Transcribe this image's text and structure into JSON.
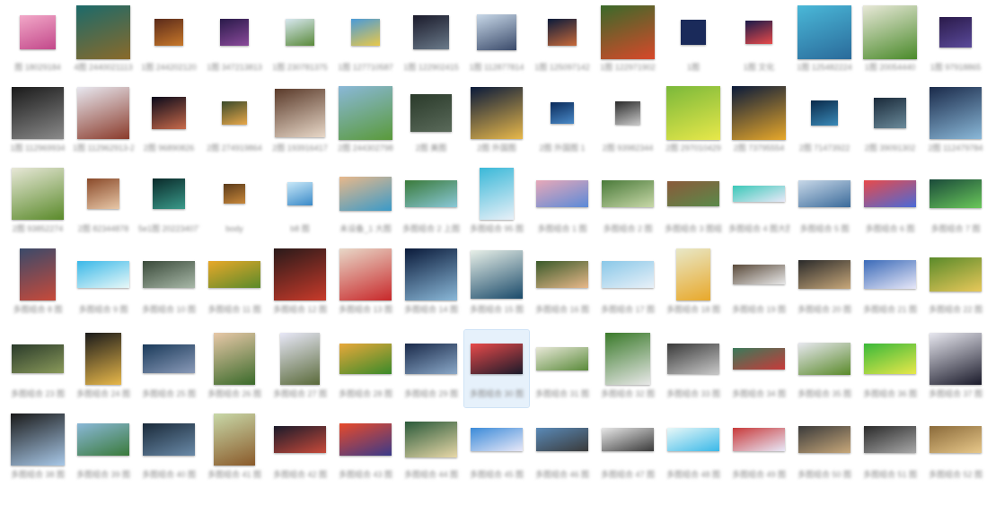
{
  "explorer": {
    "view": "large-icons",
    "selected_index": 67,
    "columns": 15,
    "rows": 6,
    "items": [
      {
        "name": "图 18029184",
        "thumb": {
          "w": 40,
          "h": 38,
          "c1": "#f2a8c8",
          "c2": "#c2488a"
        }
      },
      {
        "name": "4图 2440021113",
        "thumb": {
          "w": 60,
          "h": 60,
          "c1": "#1c6a6a",
          "c2": "#8a6a2a"
        }
      },
      {
        "name": "1图 244202120",
        "thumb": {
          "w": 32,
          "h": 30,
          "c1": "#5a2a1a",
          "c2": "#c8782a"
        }
      },
      {
        "name": "1图 347213813",
        "thumb": {
          "w": 32,
          "h": 30,
          "c1": "#2a1a4a",
          "c2": "#8a4a9a"
        }
      },
      {
        "name": "1图 230781375",
        "thumb": {
          "w": 32,
          "h": 30,
          "c1": "#d8e8f0",
          "c2": "#5a8a3a"
        }
      },
      {
        "name": "1图 127710587",
        "thumb": {
          "w": 32,
          "h": 30,
          "c1": "#4a9ad8",
          "c2": "#e8c84a"
        }
      },
      {
        "name": "1图 122902415",
        "thumb": {
          "w": 40,
          "h": 38,
          "c1": "#1a1a2a",
          "c2": "#6a7a8a"
        }
      },
      {
        "name": "1图 112877814",
        "thumb": {
          "w": 44,
          "h": 40,
          "c1": "#c8d8e8",
          "c2": "#3a4a6a"
        }
      },
      {
        "name": "1图 125097142",
        "thumb": {
          "w": 32,
          "h": 30,
          "c1": "#0a1a3a",
          "c2": "#c86a3a"
        }
      },
      {
        "name": "1图 122971902",
        "thumb": {
          "w": 60,
          "h": 60,
          "c1": "#3a6a2a",
          "c2": "#d8482a"
        }
      },
      {
        "name": "1图",
        "thumb": {
          "w": 28,
          "h": 28,
          "c1": "#1a2a5a",
          "c2": "#1a2a5a"
        }
      },
      {
        "name": "1图 文化",
        "thumb": {
          "w": 30,
          "h": 26,
          "c1": "#1a1a4a",
          "c2": "#e84a4a"
        }
      },
      {
        "name": "1图 125482224",
        "thumb": {
          "w": 60,
          "h": 60,
          "c1": "#4ab8d8",
          "c2": "#2a6a9a"
        }
      },
      {
        "name": "1图 20054440",
        "thumb": {
          "w": 60,
          "h": 60,
          "c1": "#e8e8d8",
          "c2": "#4a8a2a"
        }
      },
      {
        "name": "1图 97918865",
        "thumb": {
          "w": 36,
          "h": 34,
          "c1": "#2a1a4a",
          "c2": "#5a4a9a"
        }
      },
      {
        "name": "1图 112969934",
        "thumb": {
          "w": 58,
          "h": 58,
          "c1": "#1a1a1a",
          "c2": "#8a8a8a"
        }
      },
      {
        "name": "1图 112962913-2",
        "thumb": {
          "w": 58,
          "h": 58,
          "c1": "#e8e8f0",
          "c2": "#8a3a2a"
        }
      },
      {
        "name": "2图 96890826",
        "thumb": {
          "w": 38,
          "h": 36,
          "c1": "#0a0a1a",
          "c2": "#c86a4a"
        }
      },
      {
        "name": "2图 274919864",
        "thumb": {
          "w": 28,
          "h": 26,
          "c1": "#3a4a2a",
          "c2": "#e8a84a"
        }
      },
      {
        "name": "2图 193916417",
        "thumb": {
          "w": 56,
          "h": 54,
          "c1": "#5a3a2a",
          "c2": "#e8d8c8"
        }
      },
      {
        "name": "2图 244302798",
        "thumb": {
          "w": 60,
          "h": 60,
          "c1": "#8ab8d8",
          "c2": "#5a9a3a"
        }
      },
      {
        "name": "2图 美图",
        "thumb": {
          "w": 46,
          "h": 42,
          "c1": "#2a3a2a",
          "c2": "#5a6a5a"
        }
      },
      {
        "name": "2图 外国图",
        "thumb": {
          "w": 58,
          "h": 58,
          "c1": "#0a1a3a",
          "c2": "#e8b84a"
        }
      },
      {
        "name": "2图 外国图 1",
        "thumb": {
          "w": 26,
          "h": 24,
          "c1": "#0a2a5a",
          "c2": "#4a8ac8"
        }
      },
      {
        "name": "2图 93982344",
        "thumb": {
          "w": 28,
          "h": 26,
          "c1": "#2a2a2a",
          "c2": "#c8c8c8"
        }
      },
      {
        "name": "2图 297010429",
        "thumb": {
          "w": 60,
          "h": 60,
          "c1": "#7ab83a",
          "c2": "#e8e84a"
        }
      },
      {
        "name": "2图 73795554",
        "thumb": {
          "w": 60,
          "h": 60,
          "c1": "#0a1a3a",
          "c2": "#e8a82a"
        }
      },
      {
        "name": "2图 71473922",
        "thumb": {
          "w": 30,
          "h": 28,
          "c1": "#0a2a4a",
          "c2": "#3a8ab8"
        }
      },
      {
        "name": "2图 39091302",
        "thumb": {
          "w": 36,
          "h": 34,
          "c1": "#1a2a3a",
          "c2": "#6a8a9a"
        }
      },
      {
        "name": "2图 112479784",
        "thumb": {
          "w": 58,
          "h": 58,
          "c1": "#1a2a4a",
          "c2": "#8ab8d8"
        }
      },
      {
        "name": "2图 93852274",
        "thumb": {
          "w": 58,
          "h": 58,
          "c1": "#e8e8d8",
          "c2": "#5a8a2a"
        }
      },
      {
        "name": "2图 82344878",
        "thumb": {
          "w": 36,
          "h": 34,
          "c1": "#8a4a2a",
          "c2": "#e8c8a8"
        }
      },
      {
        "name": "5e1图 20223407741-2",
        "thumb": {
          "w": 36,
          "h": 34,
          "c1": "#0a2a2a",
          "c2": "#3a9a8a"
        }
      },
      {
        "name": "body",
        "thumb": {
          "w": 24,
          "h": 22,
          "c1": "#5a3a1a",
          "c2": "#c8883a"
        }
      },
      {
        "name": "b8 图",
        "thumb": {
          "w": 28,
          "h": 26,
          "c1": "#c8e8f8",
          "c2": "#3a8ac8"
        }
      },
      {
        "name": "未设备_1 大图",
        "thumb": {
          "w": 58,
          "h": 38,
          "c1": "#e8b88a",
          "c2": "#3a9ac8"
        }
      },
      {
        "name": "多图组合 2 上图",
        "thumb": {
          "w": 58,
          "h": 30,
          "c1": "#3a7a3a",
          "c2": "#8ac8d8"
        }
      },
      {
        "name": "多图组合 95 图",
        "thumb": {
          "w": 38,
          "h": 58,
          "c1": "#3ab8d8",
          "c2": "#e8f0f8"
        }
      },
      {
        "name": "多图组合 1 图",
        "thumb": {
          "w": 58,
          "h": 30,
          "c1": "#e8a8b8",
          "c2": "#5a8ad8"
        }
      },
      {
        "name": "多图组合 2 图",
        "thumb": {
          "w": 58,
          "h": 30,
          "c1": "#4a7a3a",
          "c2": "#c8d8a8"
        }
      },
      {
        "name": "多图组合 3 图组",
        "thumb": {
          "w": 58,
          "h": 28,
          "c1": "#8a5a3a",
          "c2": "#5a8a4a"
        }
      },
      {
        "name": "多图组合 4 图大图组",
        "thumb": {
          "w": 58,
          "h": 18,
          "c1": "#3ac8b8",
          "c2": "#e8e8f8"
        }
      },
      {
        "name": "多图组合 5 图",
        "thumb": {
          "w": 58,
          "h": 30,
          "c1": "#c8d8e8",
          "c2": "#3a6a9a"
        }
      },
      {
        "name": "多图组合 6 图",
        "thumb": {
          "w": 58,
          "h": 30,
          "c1": "#e84a4a",
          "c2": "#4a6ad8"
        }
      },
      {
        "name": "多图组合 7 图",
        "thumb": {
          "w": 58,
          "h": 32,
          "c1": "#1a4a3a",
          "c2": "#6ac85a"
        }
      },
      {
        "name": "多图组合 8 图",
        "thumb": {
          "w": 40,
          "h": 58,
          "c1": "#3a4a6a",
          "c2": "#c84a3a"
        }
      },
      {
        "name": "多图组合 9 图",
        "thumb": {
          "w": 58,
          "h": 30,
          "c1": "#3ab8e8",
          "c2": "#e8f8f8"
        }
      },
      {
        "name": "多图组合 10 图",
        "thumb": {
          "w": 58,
          "h": 30,
          "c1": "#3a4a3a",
          "c2": "#a8b8a8"
        }
      },
      {
        "name": "多图组合 11 图",
        "thumb": {
          "w": 58,
          "h": 30,
          "c1": "#e8a82a",
          "c2": "#5a8a2a"
        }
      },
      {
        "name": "多图组合 12 图",
        "thumb": {
          "w": 58,
          "h": 58,
          "c1": "#2a1a1a",
          "c2": "#c83a2a"
        }
      },
      {
        "name": "多图组合 13 图",
        "thumb": {
          "w": 58,
          "h": 58,
          "c1": "#e8d8c8",
          "c2": "#c8282a"
        }
      },
      {
        "name": "多图组合 14 图",
        "thumb": {
          "w": 58,
          "h": 58,
          "c1": "#0a1a3a",
          "c2": "#8ab8d8"
        }
      },
      {
        "name": "多图组合 15 图",
        "thumb": {
          "w": 58,
          "h": 54,
          "c1": "#e8f0e8",
          "c2": "#1a4a6a"
        }
      },
      {
        "name": "多图组合 16 图",
        "thumb": {
          "w": 58,
          "h": 30,
          "c1": "#3a5a2a",
          "c2": "#e8b88a"
        }
      },
      {
        "name": "多图组合 17 图",
        "thumb": {
          "w": 58,
          "h": 30,
          "c1": "#8ac8e8",
          "c2": "#e8f0f8"
        }
      },
      {
        "name": "多图组合 18 图",
        "thumb": {
          "w": 38,
          "h": 58,
          "c1": "#e8e8c8",
          "c2": "#e8a82a"
        }
      },
      {
        "name": "多图组合 19 图",
        "thumb": {
          "w": 58,
          "h": 22,
          "c1": "#5a4a3a",
          "c2": "#e8e8e8"
        }
      },
      {
        "name": "多图组合 20 图",
        "thumb": {
          "w": 58,
          "h": 32,
          "c1": "#2a2a2a",
          "c2": "#c8a87a"
        }
      },
      {
        "name": "多图组合 21 图",
        "thumb": {
          "w": 58,
          "h": 32,
          "c1": "#3a6ab8",
          "c2": "#e8e8f8"
        }
      },
      {
        "name": "多图组合 22 图",
        "thumb": {
          "w": 58,
          "h": 38,
          "c1": "#5a8a2a",
          "c2": "#e8c85a"
        }
      },
      {
        "name": "多图组合 23 图",
        "thumb": {
          "w": 58,
          "h": 32,
          "c1": "#2a3a2a",
          "c2": "#8a9a5a"
        }
      },
      {
        "name": "多图组合 24 图",
        "thumb": {
          "w": 40,
          "h": 58,
          "c1": "#1a1a1a",
          "c2": "#e8b84a"
        }
      },
      {
        "name": "多图组合 25 图",
        "thumb": {
          "w": 58,
          "h": 32,
          "c1": "#1a3a5a",
          "c2": "#8a9ab8"
        }
      },
      {
        "name": "多图组合 26 图",
        "thumb": {
          "w": 46,
          "h": 58,
          "c1": "#e8c8a8",
          "c2": "#3a6a2a"
        }
      },
      {
        "name": "多图组合 27 图",
        "thumb": {
          "w": 44,
          "h": 58,
          "c1": "#e8e8f8",
          "c2": "#5a6a3a"
        }
      },
      {
        "name": "多图组合 28 图",
        "thumb": {
          "w": 58,
          "h": 34,
          "c1": "#e8a83a",
          "c2": "#3a8a2a"
        }
      },
      {
        "name": "多图组合 29 图",
        "thumb": {
          "w": 58,
          "h": 34,
          "c1": "#1a2a4a",
          "c2": "#8aa8c8"
        }
      },
      {
        "name": "多图组合 30 图",
        "thumb": {
          "w": 58,
          "h": 34,
          "c1": "#e84a4a",
          "c2": "#1a1a2a"
        }
      },
      {
        "name": "多图组合 31 图",
        "thumb": {
          "w": 58,
          "h": 26,
          "c1": "#e8e8d8",
          "c2": "#5a8a3a"
        }
      },
      {
        "name": "多图组合 32 图",
        "thumb": {
          "w": 50,
          "h": 58,
          "c1": "#3a7a2a",
          "c2": "#e8e8e8"
        }
      },
      {
        "name": "多图组合 33 图",
        "thumb": {
          "w": 58,
          "h": 34,
          "c1": "#3a3a3a",
          "c2": "#c8c8c8"
        }
      },
      {
        "name": "多图组合 34 图",
        "thumb": {
          "w": 58,
          "h": 24,
          "c1": "#3a7a5a",
          "c2": "#c83a3a"
        }
      },
      {
        "name": "多图组合 35 图",
        "thumb": {
          "w": 58,
          "h": 36,
          "c1": "#e8e8f0",
          "c2": "#5a8a2a"
        }
      },
      {
        "name": "多图组合 36 图",
        "thumb": {
          "w": 58,
          "h": 34,
          "c1": "#3ab83a",
          "c2": "#e8e84a"
        }
      },
      {
        "name": "多图组合 37 图",
        "thumb": {
          "w": 58,
          "h": 58,
          "c1": "#e8e8f0",
          "c2": "#1a1a2a"
        }
      },
      {
        "name": "多图组合 38 图",
        "thumb": {
          "w": 60,
          "h": 58,
          "c1": "#1a1a1a",
          "c2": "#a8c8e8"
        }
      },
      {
        "name": "多图组合 39 图",
        "thumb": {
          "w": 58,
          "h": 36,
          "c1": "#8ab8d8",
          "c2": "#3a7a3a"
        }
      },
      {
        "name": "多图组合 40 图",
        "thumb": {
          "w": 58,
          "h": 36,
          "c1": "#1a2a3a",
          "c2": "#6a8aa8"
        }
      },
      {
        "name": "多图组合 41 图",
        "thumb": {
          "w": 46,
          "h": 58,
          "c1": "#c8d8a8",
          "c2": "#8a5a2a"
        }
      },
      {
        "name": "多图组合 42 图",
        "thumb": {
          "w": 58,
          "h": 30,
          "c1": "#1a1a2a",
          "c2": "#c84a3a"
        }
      },
      {
        "name": "多图组合 43 图",
        "thumb": {
          "w": 58,
          "h": 36,
          "c1": "#e84a2a",
          "c2": "#3a3a8a"
        }
      },
      {
        "name": "多图组合 44 图",
        "thumb": {
          "w": 58,
          "h": 40,
          "c1": "#2a5a3a",
          "c2": "#e8d8a8"
        }
      },
      {
        "name": "多图组合 45 图",
        "thumb": {
          "w": 58,
          "h": 26,
          "c1": "#3a8ad8",
          "c2": "#e8e8f8"
        }
      },
      {
        "name": "多图组合 46 图",
        "thumb": {
          "w": 58,
          "h": 26,
          "c1": "#5a8ab8",
          "c2": "#3a3a3a"
        }
      },
      {
        "name": "多图组合 47 图",
        "thumb": {
          "w": 58,
          "h": 26,
          "c1": "#e8e8e8",
          "c2": "#3a3a3a"
        }
      },
      {
        "name": "多图组合 48 图",
        "thumb": {
          "w": 58,
          "h": 26,
          "c1": "#e8f8f8",
          "c2": "#3ab8e8"
        }
      },
      {
        "name": "多图组合 49 图",
        "thumb": {
          "w": 58,
          "h": 26,
          "c1": "#c83a3a",
          "c2": "#e8e8f8"
        }
      },
      {
        "name": "多图组合 50 图",
        "thumb": {
          "w": 58,
          "h": 30,
          "c1": "#3a3a3a",
          "c2": "#c8a87a"
        }
      },
      {
        "name": "多图组合 51 图",
        "thumb": {
          "w": 58,
          "h": 30,
          "c1": "#2a2a2a",
          "c2": "#a8a8a8"
        }
      },
      {
        "name": "多图组合 52 图",
        "thumb": {
          "w": 58,
          "h": 30,
          "c1": "#8a6a3a",
          "c2": "#e8c88a"
        }
      }
    ]
  }
}
